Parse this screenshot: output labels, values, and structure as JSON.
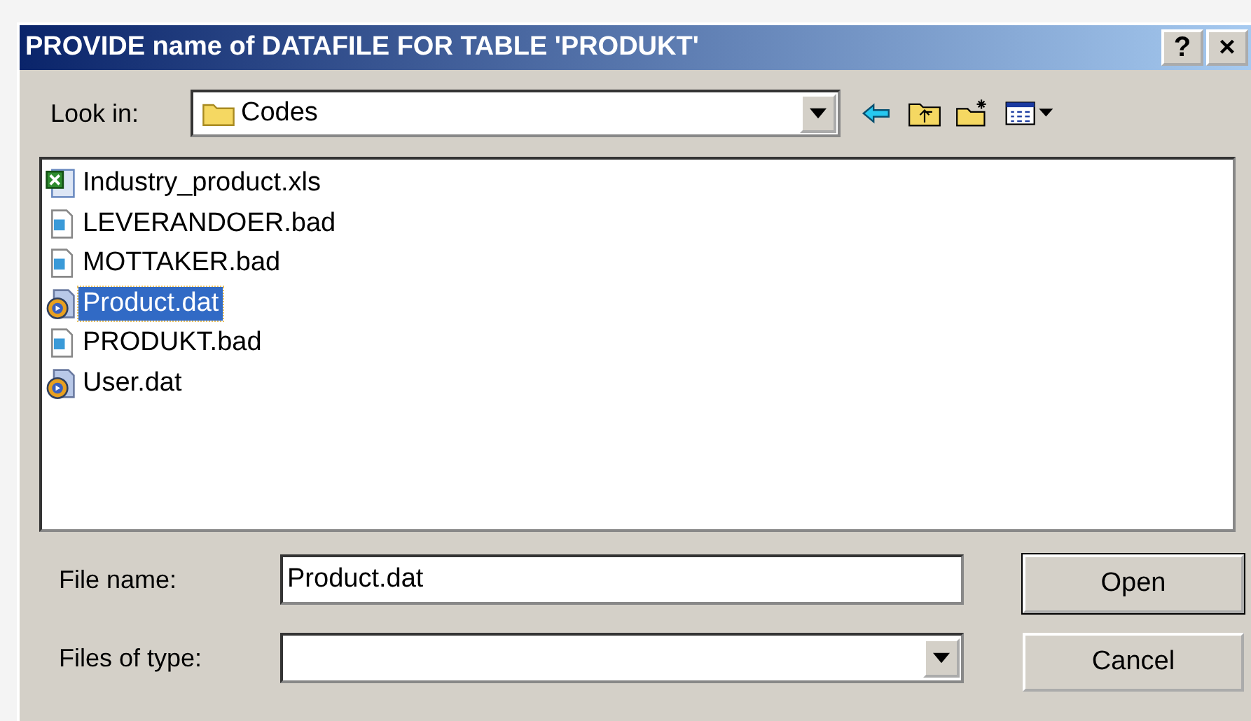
{
  "window": {
    "title": "PROVIDE name of DATAFILE FOR TABLE 'PRODUKT'",
    "buttons": [
      "?",
      "×"
    ]
  },
  "look_in": {
    "label": "Look in:",
    "value": "Codes"
  },
  "files": [
    {
      "name": "Industry_product.xls",
      "kind": "xls",
      "selected": false
    },
    {
      "name": "LEVERANDOER.bad",
      "kind": "bad",
      "selected": false
    },
    {
      "name": "MOTTAKER.bad",
      "kind": "bad",
      "selected": false
    },
    {
      "name": "Product.dat",
      "kind": "dat",
      "selected": true
    },
    {
      "name": "PRODUKT.bad",
      "kind": "bad",
      "selected": false
    },
    {
      "name": "User.dat",
      "kind": "dat",
      "selected": false
    }
  ],
  "file_name": {
    "label": "File name:",
    "value": "Product.dat"
  },
  "file_type": {
    "label": "Files of type:"
  },
  "buttons": [
    "Open",
    "Cancel"
  ]
}
